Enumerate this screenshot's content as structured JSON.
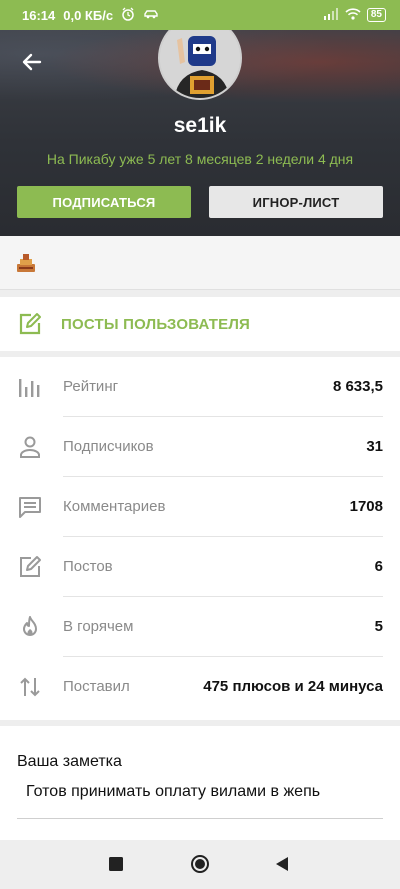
{
  "status_bar": {
    "time": "16:14",
    "net_speed": "0,0 КБ/с",
    "battery": "85"
  },
  "profile": {
    "username": "se1ik",
    "tenure": "На Пикабу уже 5 лет 8 месяцев 2 недели 4 дня",
    "subscribe_label": "ПОДПИСАТЬСЯ",
    "ignore_label": "ИГНОР-ЛИСТ"
  },
  "posts_link": {
    "label": "ПОСТЫ ПОЛЬЗОВАТЕЛЯ"
  },
  "stats": [
    {
      "icon": "rating-chart-icon",
      "label": "Рейтинг",
      "value": "8 633,5"
    },
    {
      "icon": "person-icon",
      "label": "Подписчиков",
      "value": "31"
    },
    {
      "icon": "comment-icon",
      "label": "Комментариев",
      "value": "1708"
    },
    {
      "icon": "edit-icon",
      "label": "Постов",
      "value": "6"
    },
    {
      "icon": "flame-icon",
      "label": "В горячем",
      "value": "5"
    },
    {
      "icon": "sort-arrows-icon",
      "label": "Поставил",
      "value": "475 плюсов и 24 минуса"
    }
  ],
  "note": {
    "title": "Ваша заметка",
    "text": "Готов принимать оплату вилами в жепь"
  },
  "colors": {
    "accent": "#8dbb52",
    "header_bg": "#2f3238",
    "page_bg": "#eeeeee"
  }
}
